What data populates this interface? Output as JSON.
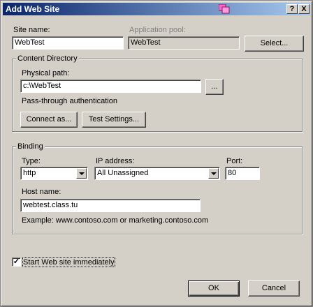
{
  "window": {
    "title": "Add Web Site",
    "help_button": "?",
    "close_button": "X"
  },
  "site": {
    "name_label": "Site name:",
    "name_value": "WebTest",
    "pool_label": "Application pool:",
    "pool_value": "WebTest",
    "select_button": "Select..."
  },
  "content": {
    "group_title": "Content Directory",
    "path_label": "Physical path:",
    "path_value": "c:\\WebTest",
    "browse_button": "...",
    "auth_text": "Pass-through authentication",
    "connect_button": "Connect as...",
    "test_button": "Test Settings..."
  },
  "binding": {
    "group_title": "Binding",
    "type_label": "Type:",
    "type_value": "http",
    "ip_label": "IP address:",
    "ip_value": "All Unassigned",
    "port_label": "Port:",
    "port_value": "80",
    "host_label": "Host name:",
    "host_value": "webtest.class.tu",
    "example_text": "Example: www.contoso.com or marketing.contoso.com"
  },
  "start": {
    "checked": true,
    "label": "Start Web site immediately"
  },
  "footer": {
    "ok_button": "OK",
    "cancel_button": "Cancel"
  }
}
